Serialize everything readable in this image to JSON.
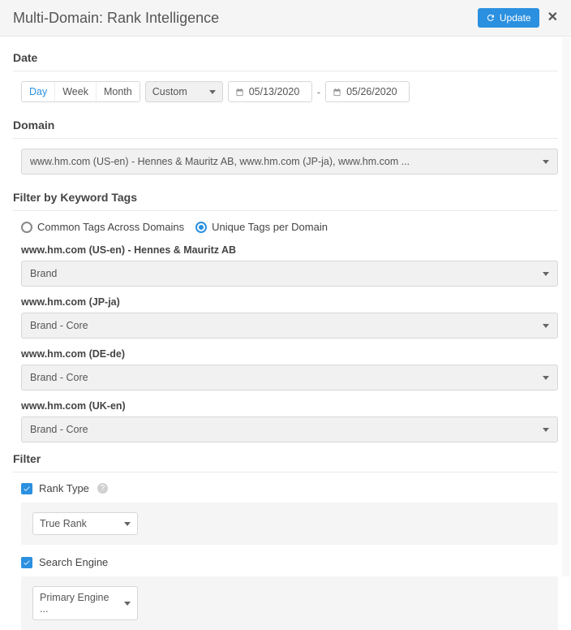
{
  "header": {
    "title": "Multi-Domain: Rank Intelligence",
    "update_label": "Update"
  },
  "date": {
    "label": "Date",
    "granularity": [
      "Day",
      "Week",
      "Month"
    ],
    "granularity_active": 0,
    "custom_label": "Custom",
    "from": "05/13/2020",
    "to": "05/26/2020",
    "dash": "-"
  },
  "domain": {
    "label": "Domain",
    "value": "www.hm.com (US-en) - Hennes & Mauritz AB, www.hm.com (JP-ja), www.hm.com ..."
  },
  "keyword_tags": {
    "label": "Filter by Keyword Tags",
    "radios": {
      "common": "Common Tags Across Domains",
      "unique": "Unique Tags per Domain",
      "selected": "unique"
    },
    "rows": [
      {
        "domain": "www.hm.com (US-en) - Hennes & Mauritz AB",
        "tag": "Brand"
      },
      {
        "domain": "www.hm.com (JP-ja)",
        "tag": "Brand - Core"
      },
      {
        "domain": "www.hm.com (DE-de)",
        "tag": "Brand - Core"
      },
      {
        "domain": "www.hm.com (UK-en)",
        "tag": "Brand - Core"
      }
    ]
  },
  "filter": {
    "label": "Filter",
    "rank_type": {
      "checked": true,
      "label": "Rank Type",
      "value": "True Rank"
    },
    "search_engine": {
      "checked": true,
      "label": "Search Engine",
      "value": "Primary Engine ..."
    }
  }
}
